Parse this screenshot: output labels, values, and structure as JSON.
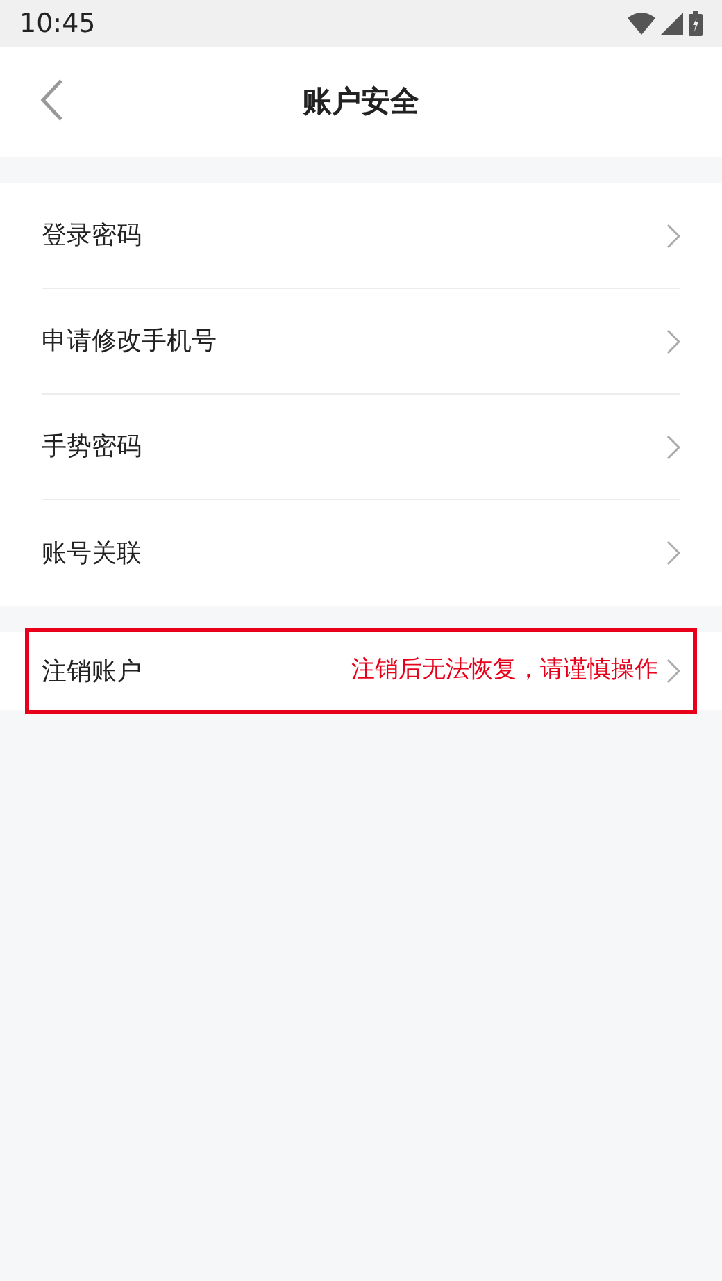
{
  "status_bar": {
    "time": "10:45"
  },
  "header": {
    "title": "账户安全"
  },
  "groups": [
    {
      "items": [
        {
          "label": "登录密码",
          "highlighted": false
        },
        {
          "label": "申请修改手机号",
          "highlighted": false
        },
        {
          "label": "手势密码",
          "highlighted": false
        },
        {
          "label": "账号关联",
          "highlighted": false
        }
      ]
    },
    {
      "items": [
        {
          "label": "注销账户",
          "note": "注销后无法恢复，请谨慎操作",
          "highlighted": true
        }
      ]
    }
  ]
}
